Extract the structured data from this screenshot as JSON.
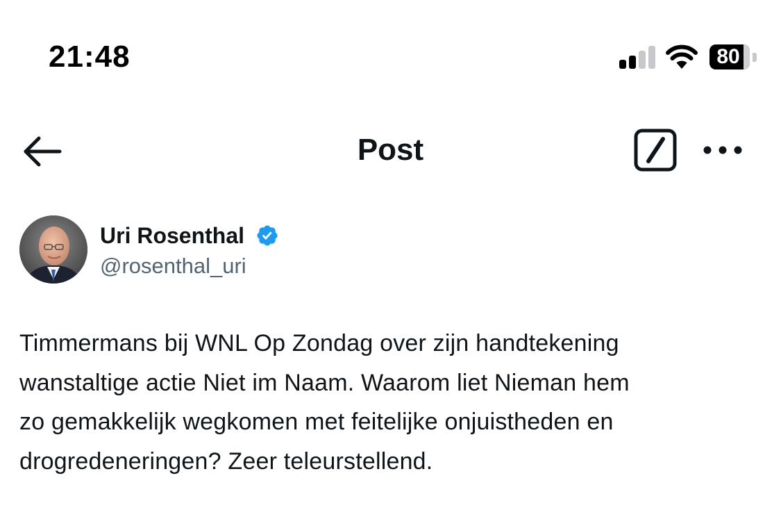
{
  "status_bar": {
    "time": "21:48",
    "battery_percent": "80",
    "battery_level": 0.8,
    "signal_bars_active": 2,
    "signal_bars_total": 4,
    "icons": [
      "cellular-signal-icon",
      "wifi-icon",
      "battery-icon"
    ]
  },
  "nav": {
    "title": "Post",
    "icons": [
      "back-arrow-icon",
      "grok-icon",
      "more-options-icon"
    ]
  },
  "author": {
    "name": "Uri Rosenthal",
    "handle": "@rosenthal_uri",
    "verified": true,
    "verified_color": "#1d9bf0"
  },
  "tweet": {
    "lines": [
      "Timmermans bij WNL Op Zondag over zijn handtekening",
      "wanstaltige actie Niet im Naam. Waarom liet Nieman hem",
      "zo gemakkelijk wegkomen met feitelijke onjuistheden en",
      "drogredeneringen? Zeer teleurstellend."
    ]
  },
  "colors": {
    "text_primary": "#0f1419",
    "text_secondary": "#536471",
    "accent": "#1d9bf0",
    "background": "#ffffff"
  }
}
